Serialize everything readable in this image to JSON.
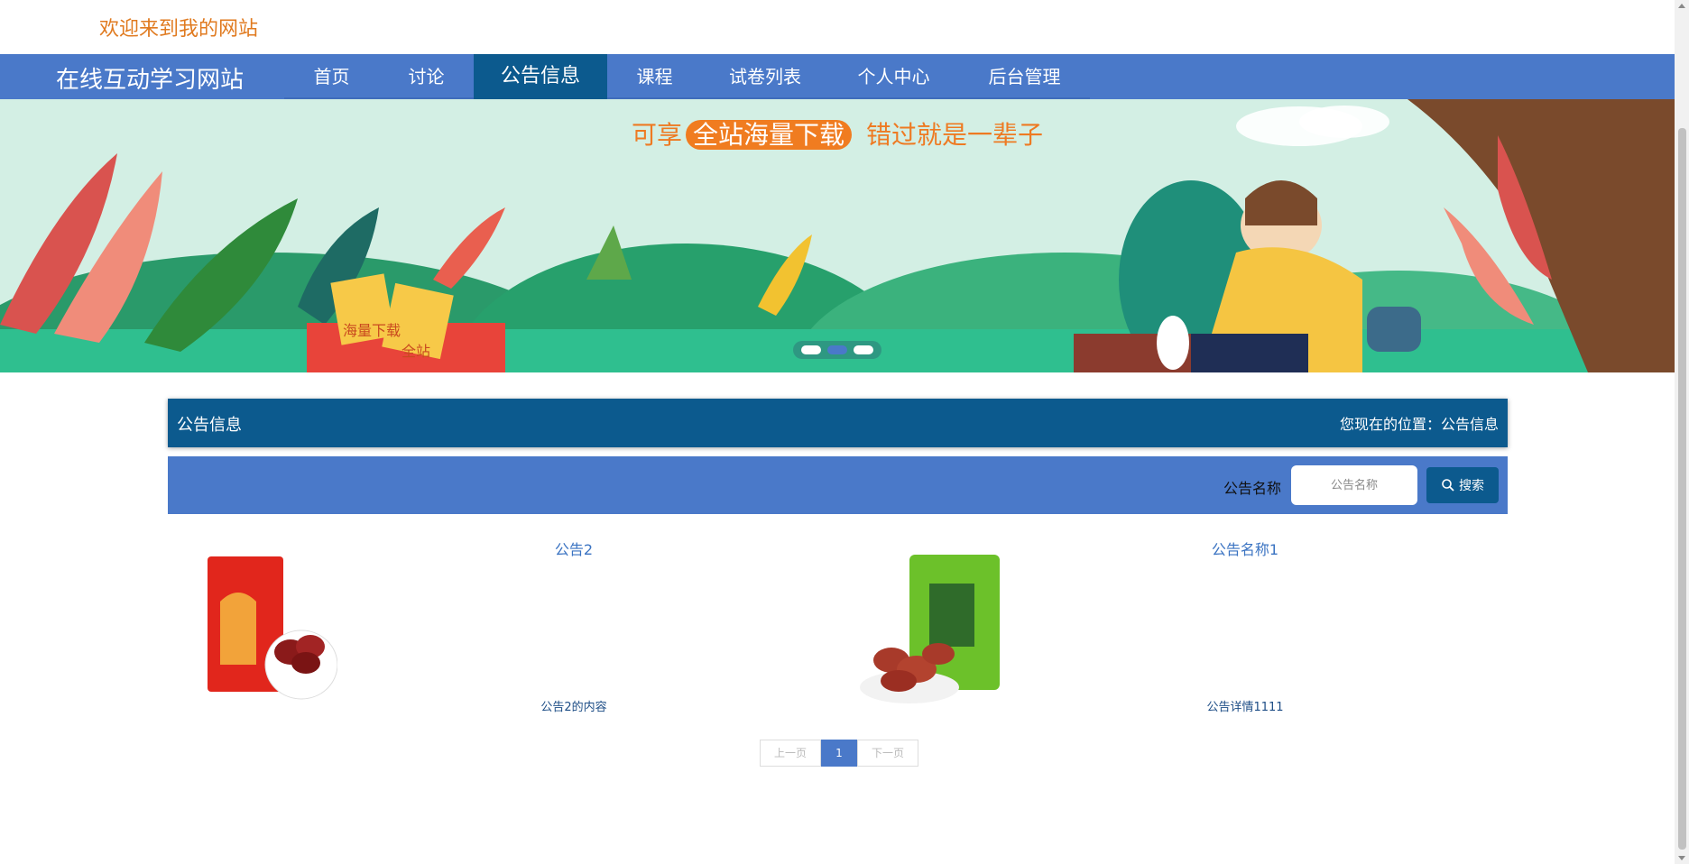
{
  "welcome": "欢迎来到我的网站",
  "brand": "在线互动学习网站",
  "nav": [
    {
      "label": "首页",
      "active": false
    },
    {
      "label": "讨论",
      "active": false
    },
    {
      "label": "公告信息",
      "active": true
    },
    {
      "label": "课程",
      "active": false
    },
    {
      "label": "试卷列表",
      "active": false
    },
    {
      "label": "个人中心",
      "active": false
    },
    {
      "label": "后台管理",
      "active": false
    }
  ],
  "banner": {
    "text_pre": "可享",
    "text_highlight": "全站海量下载",
    "text_post": "错过就是一辈子",
    "box_text_1": "海量下载",
    "box_text_2": "全站",
    "active_dot": 2
  },
  "section": {
    "title": "公告信息",
    "breadcrumb": "您现在的位置：公告信息"
  },
  "search": {
    "label": "公告名称",
    "placeholder": "公告名称",
    "button": "搜索"
  },
  "cards": [
    {
      "title": "公告2",
      "desc": "公告2的内容",
      "image": "red-date-package"
    },
    {
      "title": "公告名称1",
      "desc": "公告详情1111",
      "image": "green-date-package"
    }
  ],
  "pager": {
    "prev": "上一页",
    "current": "1",
    "next": "下一页"
  },
  "colors": {
    "nav": "#4a79c9",
    "nav_active": "#0c5a8e",
    "welcome": "#e07a1f",
    "link": "#3a73c2"
  }
}
